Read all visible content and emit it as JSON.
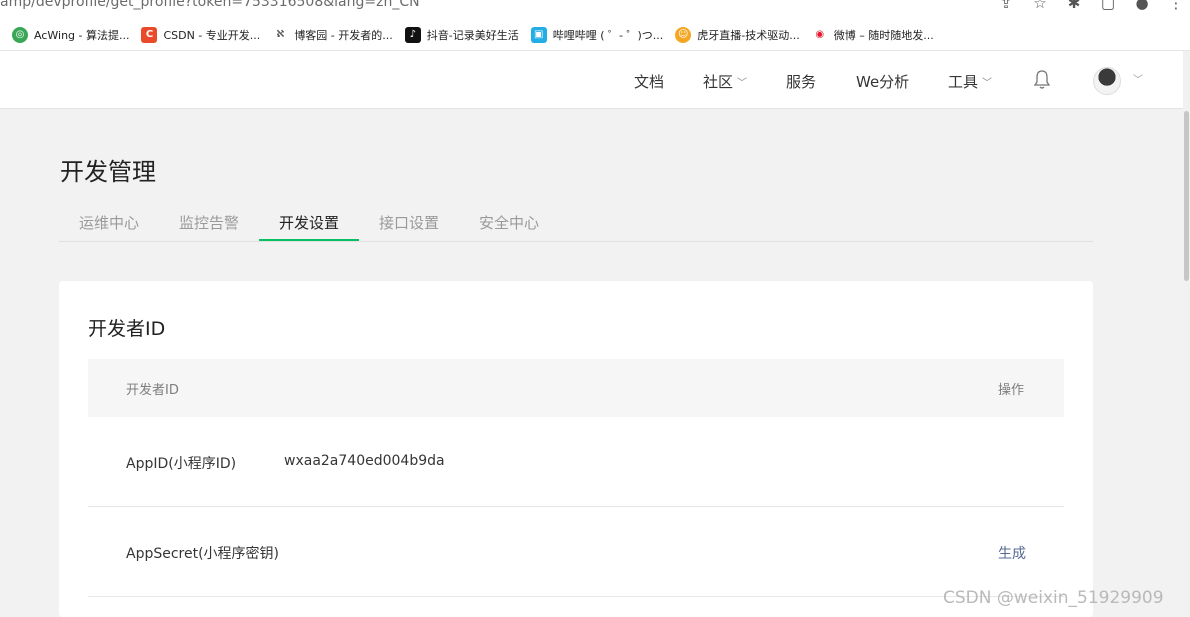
{
  "browser": {
    "url_fragment": "amp/devprofile/get_profile?token=753316508&lang=zh_CN",
    "bookmarks": [
      {
        "label": "AcWing - 算法提...",
        "icon": "acwing-icon",
        "color": "#3aa757"
      },
      {
        "label": "CSDN - 专业开发...",
        "icon": "csdn-icon",
        "color": "#e94a2b"
      },
      {
        "label": "博客园 - 开发者的...",
        "icon": "cnblogs-icon",
        "color": "#555555"
      },
      {
        "label": "抖音-记录美好生活",
        "icon": "douyin-icon",
        "color": "#111111"
      },
      {
        "label": "哔哩哔哩 ( ゜- ゜)つ...",
        "icon": "bilibili-icon",
        "color": "#23ade5"
      },
      {
        "label": "虎牙直播-技术驱动...",
        "icon": "huya-icon",
        "color": "#f5a623"
      },
      {
        "label": "微博 – 随时随地发...",
        "icon": "weibo-icon",
        "color": "#e6162d"
      }
    ]
  },
  "nav": {
    "items": [
      {
        "label": "文档",
        "dropdown": false
      },
      {
        "label": "社区",
        "dropdown": true
      },
      {
        "label": "服务",
        "dropdown": false
      },
      {
        "label": "We分析",
        "dropdown": false
      },
      {
        "label": "工具",
        "dropdown": true
      }
    ]
  },
  "page": {
    "title": "开发管理",
    "tabs": [
      {
        "label": "运维中心"
      },
      {
        "label": "监控告警"
      },
      {
        "label": "开发设置"
      },
      {
        "label": "接口设置"
      },
      {
        "label": "安全中心"
      }
    ],
    "active_tab": "开发设置",
    "accent_color": "#07c160"
  },
  "card": {
    "title": "开发者ID",
    "columns": [
      "开发者ID",
      "操作"
    ],
    "rows": [
      {
        "label": "AppID(小程序ID)",
        "value": "wxaa2a740ed004b9da",
        "action": ""
      },
      {
        "label": "AppSecret(小程序密钥)",
        "value": "",
        "action": "生成"
      }
    ],
    "link_color": "#576b95"
  },
  "watermark": "CSDN @weixin_51929909"
}
